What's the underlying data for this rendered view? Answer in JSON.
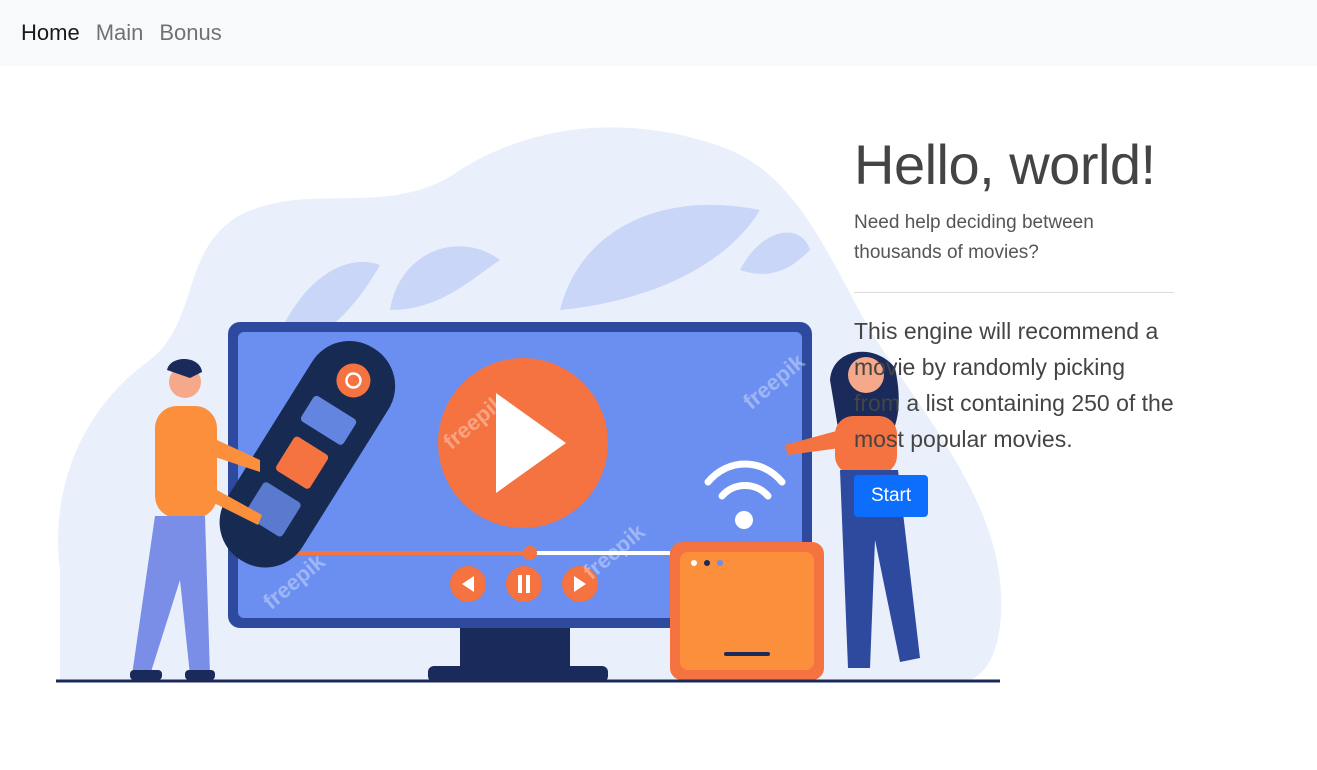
{
  "nav": {
    "items": [
      {
        "label": "Home",
        "active": true
      },
      {
        "label": "Main",
        "active": false
      },
      {
        "label": "Bonus",
        "active": false
      }
    ]
  },
  "hero": {
    "title": "Hello, world!",
    "lead": "Need help deciding between thousands of movies?",
    "body": "This engine will recommend a movie by randomly picking from a list containing 250 of the most popular movies.",
    "start_label": "Start"
  },
  "illustration": {
    "watermark": "freepik",
    "colors": {
      "blob": "#e9f0fb",
      "leaf": "#c9d6f7",
      "screen": "#6b8ff0",
      "frame": "#2e4a9e",
      "orange": "#f47340",
      "navy": "#1a2a5a"
    }
  }
}
